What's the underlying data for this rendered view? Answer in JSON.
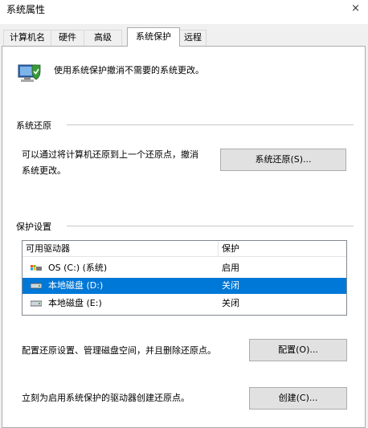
{
  "window": {
    "title": "系统属性",
    "close_glyph": "×"
  },
  "tabs": [
    {
      "label": "计算机名"
    },
    {
      "label": "硬件"
    },
    {
      "label": "高级"
    },
    {
      "label": "系统保护",
      "active": true
    },
    {
      "label": "远程"
    }
  ],
  "header": {
    "icon": "system-protection-icon",
    "text": "使用系统保护撤消不需要的系统更改。"
  },
  "restore": {
    "group_title": "系统还原",
    "description_line1": "可以通过将计算机还原到上一个还原点，撤消",
    "description_line2": "系统更改。",
    "button_label": "系统还原(S)..."
  },
  "protection": {
    "group_title": "保护设置",
    "columns": {
      "drive": "可用驱动器",
      "protection": "保护"
    },
    "drives": [
      {
        "name": "OS (C:) (系统)",
        "status": "启用",
        "icon": "system-drive-icon",
        "selected": false
      },
      {
        "name": "本地磁盘 (D:)",
        "status": "关闭",
        "icon": "local-disk-icon",
        "selected": true
      },
      {
        "name": "本地磁盘 (E:)",
        "status": "关闭",
        "icon": "local-disk-icon",
        "selected": false
      }
    ],
    "configure_text": "配置还原设置、管理磁盘空间，并且删除还原点。",
    "configure_button": "配置(O)...",
    "create_text": "立刻为启用系统保护的驱动器创建还原点。",
    "create_button": "创建(C)..."
  },
  "colors": {
    "selection": "#0078d7",
    "window": "#ffffff",
    "tab_strip": "#f0f0f0",
    "button": "#e1e1e1"
  }
}
